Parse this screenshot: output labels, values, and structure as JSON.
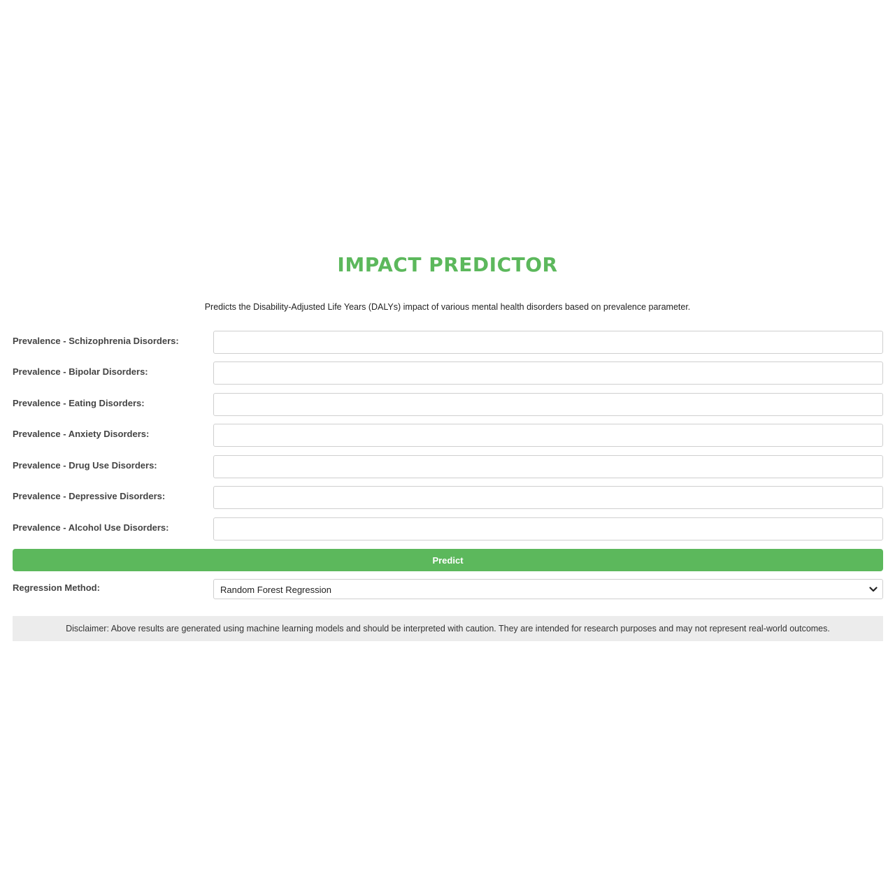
{
  "header": {
    "title": "IMPACT PREDICTOR",
    "subtitle": "Predicts the Disability-Adjusted Life Years (DALYs) impact of various mental health disorders based on prevalence parameter."
  },
  "form": {
    "fields": [
      {
        "label": "Prevalence - Schizophrenia Disorders:",
        "value": ""
      },
      {
        "label": "Prevalence - Bipolar Disorders:",
        "value": ""
      },
      {
        "label": "Prevalence - Eating Disorders:",
        "value": ""
      },
      {
        "label": "Prevalence - Anxiety Disorders:",
        "value": ""
      },
      {
        "label": "Prevalence - Drug Use Disorders:",
        "value": ""
      },
      {
        "label": "Prevalence - Depressive Disorders:",
        "value": ""
      },
      {
        "label": "Prevalence - Alcohol Use Disorders:",
        "value": ""
      }
    ],
    "predict_label": "Predict",
    "method_label": "Regression Method:",
    "method_value": "Random Forest Regression"
  },
  "disclaimer": "Disclaimer: Above results are generated using machine learning models and should be interpreted with caution. They are intended for research purposes and may not represent real-world outcomes.",
  "colors": {
    "accent": "#5cb85c",
    "disclaimer_bg": "#ececec"
  },
  "icons": {
    "select_arrow": "chevron-down-icon"
  }
}
